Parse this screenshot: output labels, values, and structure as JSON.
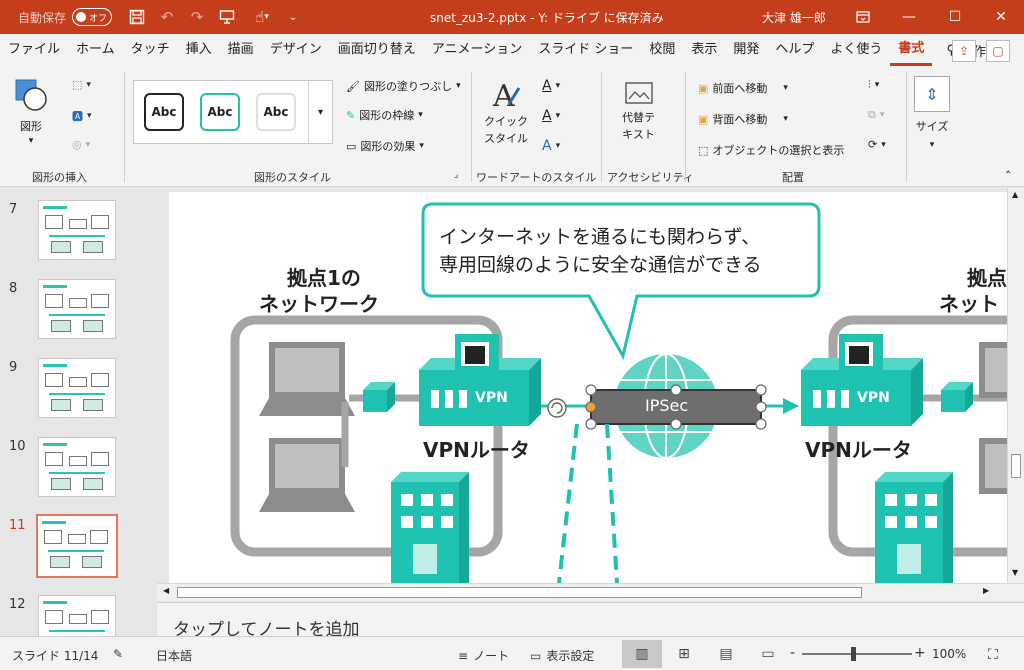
{
  "titlebar": {
    "autosave_label": "自動保存",
    "autosave_state": "オフ",
    "title": "snet_zu3-2.pptx - Y: ドライブ に保存済み",
    "user": "大津 雄一郎"
  },
  "tabs": [
    "ファイル",
    "ホーム",
    "タッチ",
    "挿入",
    "描画",
    "デザイン",
    "画面切り替え",
    "アニメーション",
    "スライド ショー",
    "校閲",
    "表示",
    "開発",
    "ヘルプ",
    "よく使う",
    "書式"
  ],
  "active_tab": "書式",
  "search_label": "操作アシ",
  "ribbon": {
    "insert_shapes": {
      "shape_label": "図形",
      "group_label": "図形の挿入"
    },
    "shape_styles": {
      "swatches": [
        "Abc",
        "Abc",
        "Abc"
      ],
      "fill_label": "図形の塗りつぶし",
      "outline_label": "図形の枠線",
      "effects_label": "図形の効果",
      "group_label": "図形のスタイル"
    },
    "wordart": {
      "quick_label1": "クイック",
      "quick_label2": "スタイル",
      "group_label": "ワードアートのスタイル"
    },
    "accessibility": {
      "alt_label1": "代替テ",
      "alt_label2": "キスト",
      "group_label": "アクセシビリティ"
    },
    "arrange": {
      "front_label": "前面へ移動",
      "back_label": "背面へ移動",
      "selection_label": "オブジェクトの選択と表示",
      "group_label": "配置"
    },
    "size": {
      "label": "サイズ"
    }
  },
  "thumbnails": [
    {
      "num": "7",
      "active": false
    },
    {
      "num": "8",
      "active": false
    },
    {
      "num": "9",
      "active": false
    },
    {
      "num": "10",
      "active": false
    },
    {
      "num": "11",
      "active": true
    },
    {
      "num": "12",
      "active": false
    }
  ],
  "slide": {
    "callout_line1": "インターネットを通るにも関わらず、",
    "callout_line2": "専用回線のように安全な通信ができる",
    "site1_line1": "拠点1の",
    "site1_line2": "ネットワーク",
    "site2_line1": "拠点",
    "site2_line2": "ネット",
    "vpn_box_label": "VPN",
    "router_label": "VPNルータ",
    "ipsec_label": "IPSec",
    "teal": "#1fc1b0",
    "teal_dark": "#14a897"
  },
  "notes_placeholder": "タップしてノートを追加",
  "status": {
    "slide_counter": "スライド 11/14",
    "language": "日本語",
    "notes_label": "ノート",
    "display_settings_label": "表示設定",
    "zoom_minus": "-",
    "zoom_plus": "+",
    "zoom": "100%"
  }
}
